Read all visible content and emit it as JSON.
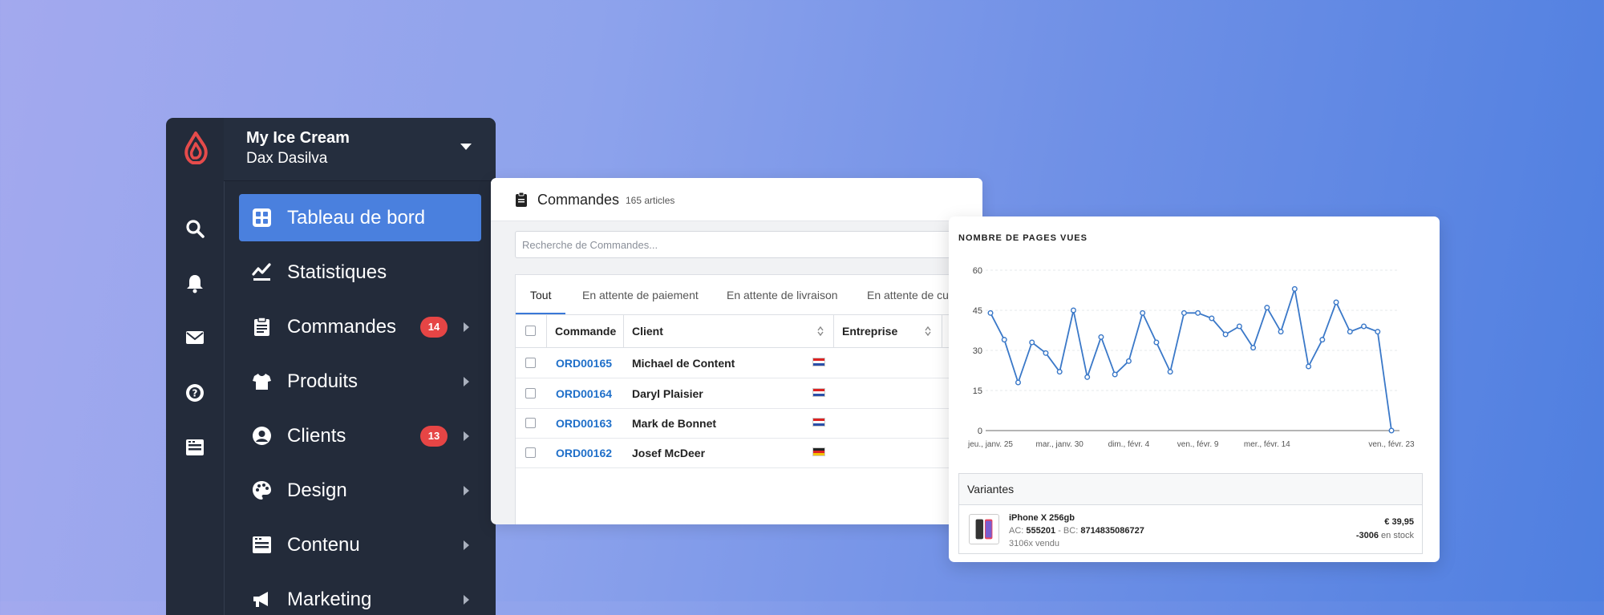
{
  "sidebar": {
    "store_name": "My Ice Cream",
    "user_name": "Dax Dasilva",
    "rail_icons": [
      "logo-icon",
      "search-icon",
      "bell-icon",
      "mail-icon",
      "help-icon",
      "content-icon"
    ],
    "items": [
      {
        "label": "Tableau de bord",
        "icon": "dashboard-icon",
        "active": true
      },
      {
        "label": "Statistiques",
        "icon": "stats-icon"
      },
      {
        "label": "Commandes",
        "icon": "orders-icon",
        "badge": "14"
      },
      {
        "label": "Produits",
        "icon": "products-icon"
      },
      {
        "label": "Clients",
        "icon": "clients-icon",
        "badge": "13"
      },
      {
        "label": "Design",
        "icon": "palette-icon"
      },
      {
        "label": "Contenu",
        "icon": "content-icon"
      },
      {
        "label": "Marketing",
        "icon": "megaphone-icon"
      }
    ]
  },
  "orders": {
    "title": "Commandes",
    "count": "165 articles",
    "search_placeholder": "Recherche de Commandes...",
    "tabs": [
      "Tout",
      "En attente de paiement",
      "En attente de livraison",
      "En attente de cueillette"
    ],
    "columns": [
      "Commande",
      "Client",
      "Entreprise"
    ],
    "rows": [
      {
        "order": "ORD00165",
        "client": "Michael de Content",
        "flag": "nl"
      },
      {
        "order": "ORD00164",
        "client": "Daryl Plaisier",
        "flag": "nl"
      },
      {
        "order": "ORD00163",
        "client": "Mark de Bonnet",
        "flag": "nl"
      },
      {
        "order": "ORD00162",
        "client": "Josef McDeer",
        "flag": "de"
      }
    ]
  },
  "chart_card": {
    "title": "NOMBRE DE PAGES VUES",
    "variants": {
      "header": "Variantes",
      "name": "iPhone X 256gb",
      "ac_label": "AC:",
      "ac_value": "555201",
      "sep": "-",
      "bc_label": "BC:",
      "bc_value": "8714835086727",
      "sold": "3106x vendu",
      "price": "€ 39,95",
      "stock_value": "-3006",
      "stock_label": "en stock"
    }
  },
  "colors": {
    "accent": "#4a80de",
    "line": "#3a78c8",
    "badge": "#e64545",
    "link": "#1f6fc9"
  },
  "chart_data": {
    "type": "line",
    "title": "NOMBRE DE PAGES VUES",
    "ylim": [
      0,
      60
    ],
    "yticks": [
      0,
      15,
      30,
      45,
      60
    ],
    "xtick_labels": [
      "jeu., janv. 25",
      "mar., janv. 30",
      "dim., févr. 4",
      "ven., févr. 9",
      "mer., févr. 14",
      "ven., févr. 23"
    ],
    "xtick_index": [
      0,
      5,
      10,
      15,
      20,
      29
    ],
    "values": [
      44,
      34,
      18,
      33,
      29,
      22,
      45,
      20,
      35,
      21,
      26,
      44,
      33,
      22,
      44,
      44,
      42,
      36,
      39,
      31,
      46,
      37,
      53,
      24,
      34,
      48,
      37,
      39,
      37,
      0
    ],
    "grid": true
  }
}
